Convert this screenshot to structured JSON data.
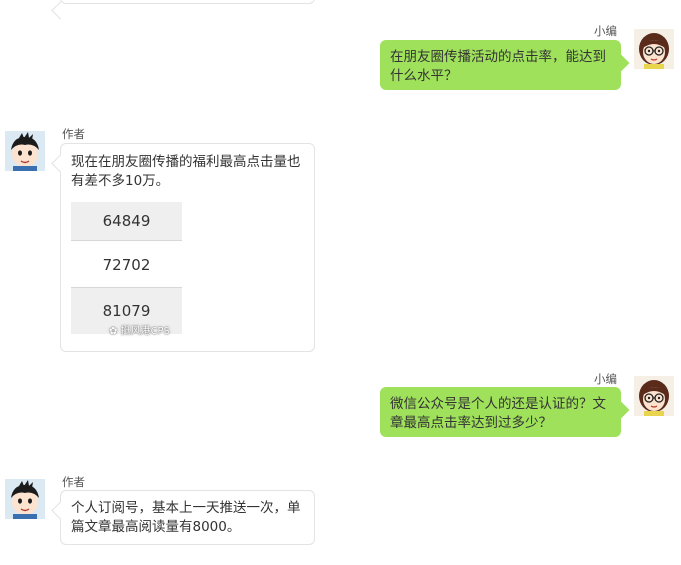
{
  "speakers": {
    "editor": "小编",
    "author": "作者"
  },
  "messages": {
    "q1": "在朋友圈传播活动的点击率，能达到什么水平？",
    "a1": "现在在朋友圈传播的福利最高点击量也有差不多10万。",
    "a1_values": [
      "64849",
      "72702",
      "81079"
    ],
    "q2": "微信公众号是个人的还是认证的？文章最高点击率达到过多少？",
    "a2": "个人订阅号，基本上一天推送一次，单篇文章最高阅读量有8000。"
  },
  "watermark": "挺风港CPS",
  "colors": {
    "right_bubble": "#9fe15b",
    "left_bubble_border": "#e3e3e3",
    "table_shade": "#efefef"
  }
}
